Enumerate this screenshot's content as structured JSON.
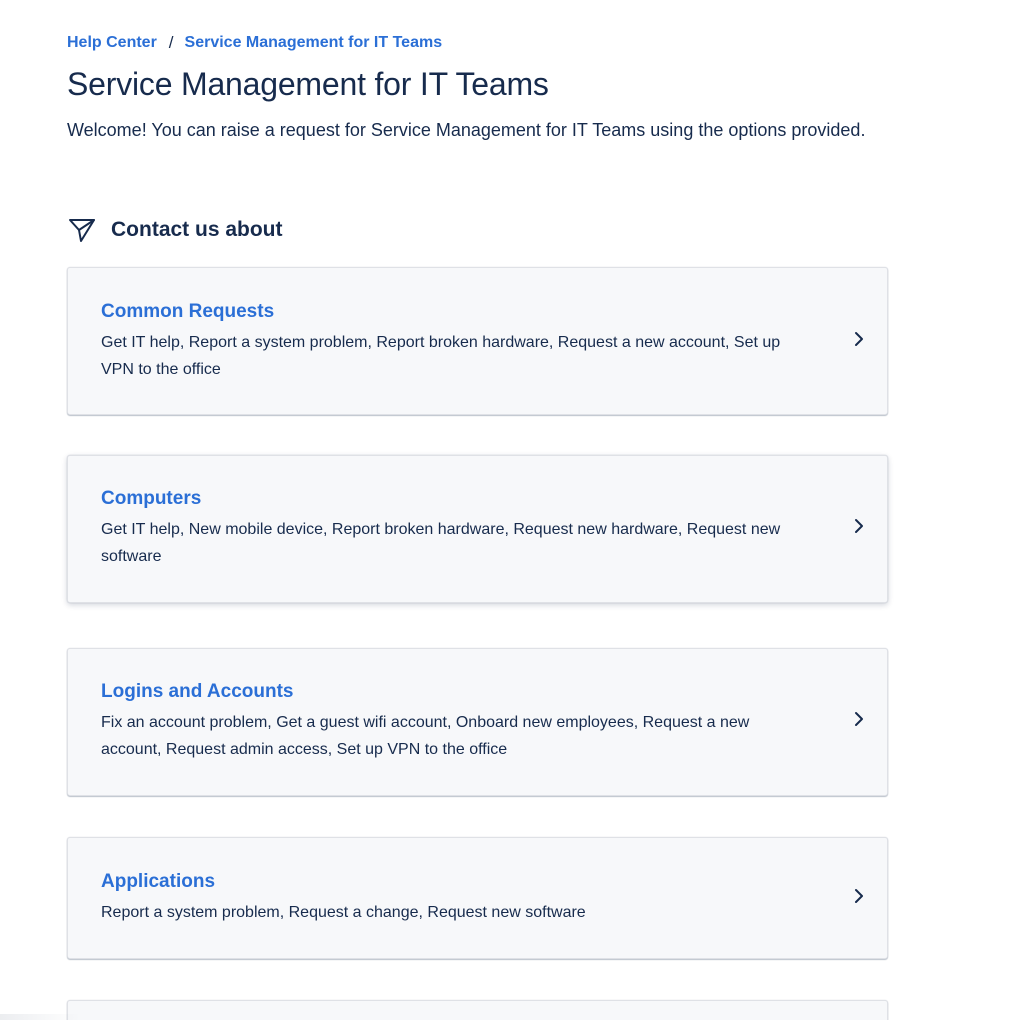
{
  "breadcrumb": {
    "home": "Help Center",
    "separator": "/",
    "current": "Service Management for IT Teams"
  },
  "page": {
    "title": "Service Management for IT Teams",
    "welcome": "Welcome! You can raise a request for Service Management for IT Teams using the options provided."
  },
  "section": {
    "icon": "send-icon",
    "heading": "Contact us about"
  },
  "cards": [
    {
      "title": "Common Requests",
      "description": "Get IT help, Report a system problem, Report broken hardware, Request a new account, Set up VPN to the office",
      "icon": "chevron-right-icon"
    },
    {
      "title": "Computers",
      "description": "Get IT help, New mobile device, Report broken hardware, Request new hardware, Request new software",
      "icon": "chevron-right-icon"
    },
    {
      "title": "Logins and Accounts",
      "description": "Fix an account problem, Get a guest wifi account, Onboard new employees, Request a new account, Request admin access, Set up VPN to the office",
      "icon": "chevron-right-icon"
    },
    {
      "title": "Applications",
      "description": "Report a system problem, Request a change, Request new software",
      "icon": "chevron-right-icon"
    }
  ],
  "colors": {
    "link": "#2b6fd6",
    "text": "#172b4d",
    "card_bg": "#f7f8fa",
    "card_border": "#dfe1e6"
  }
}
